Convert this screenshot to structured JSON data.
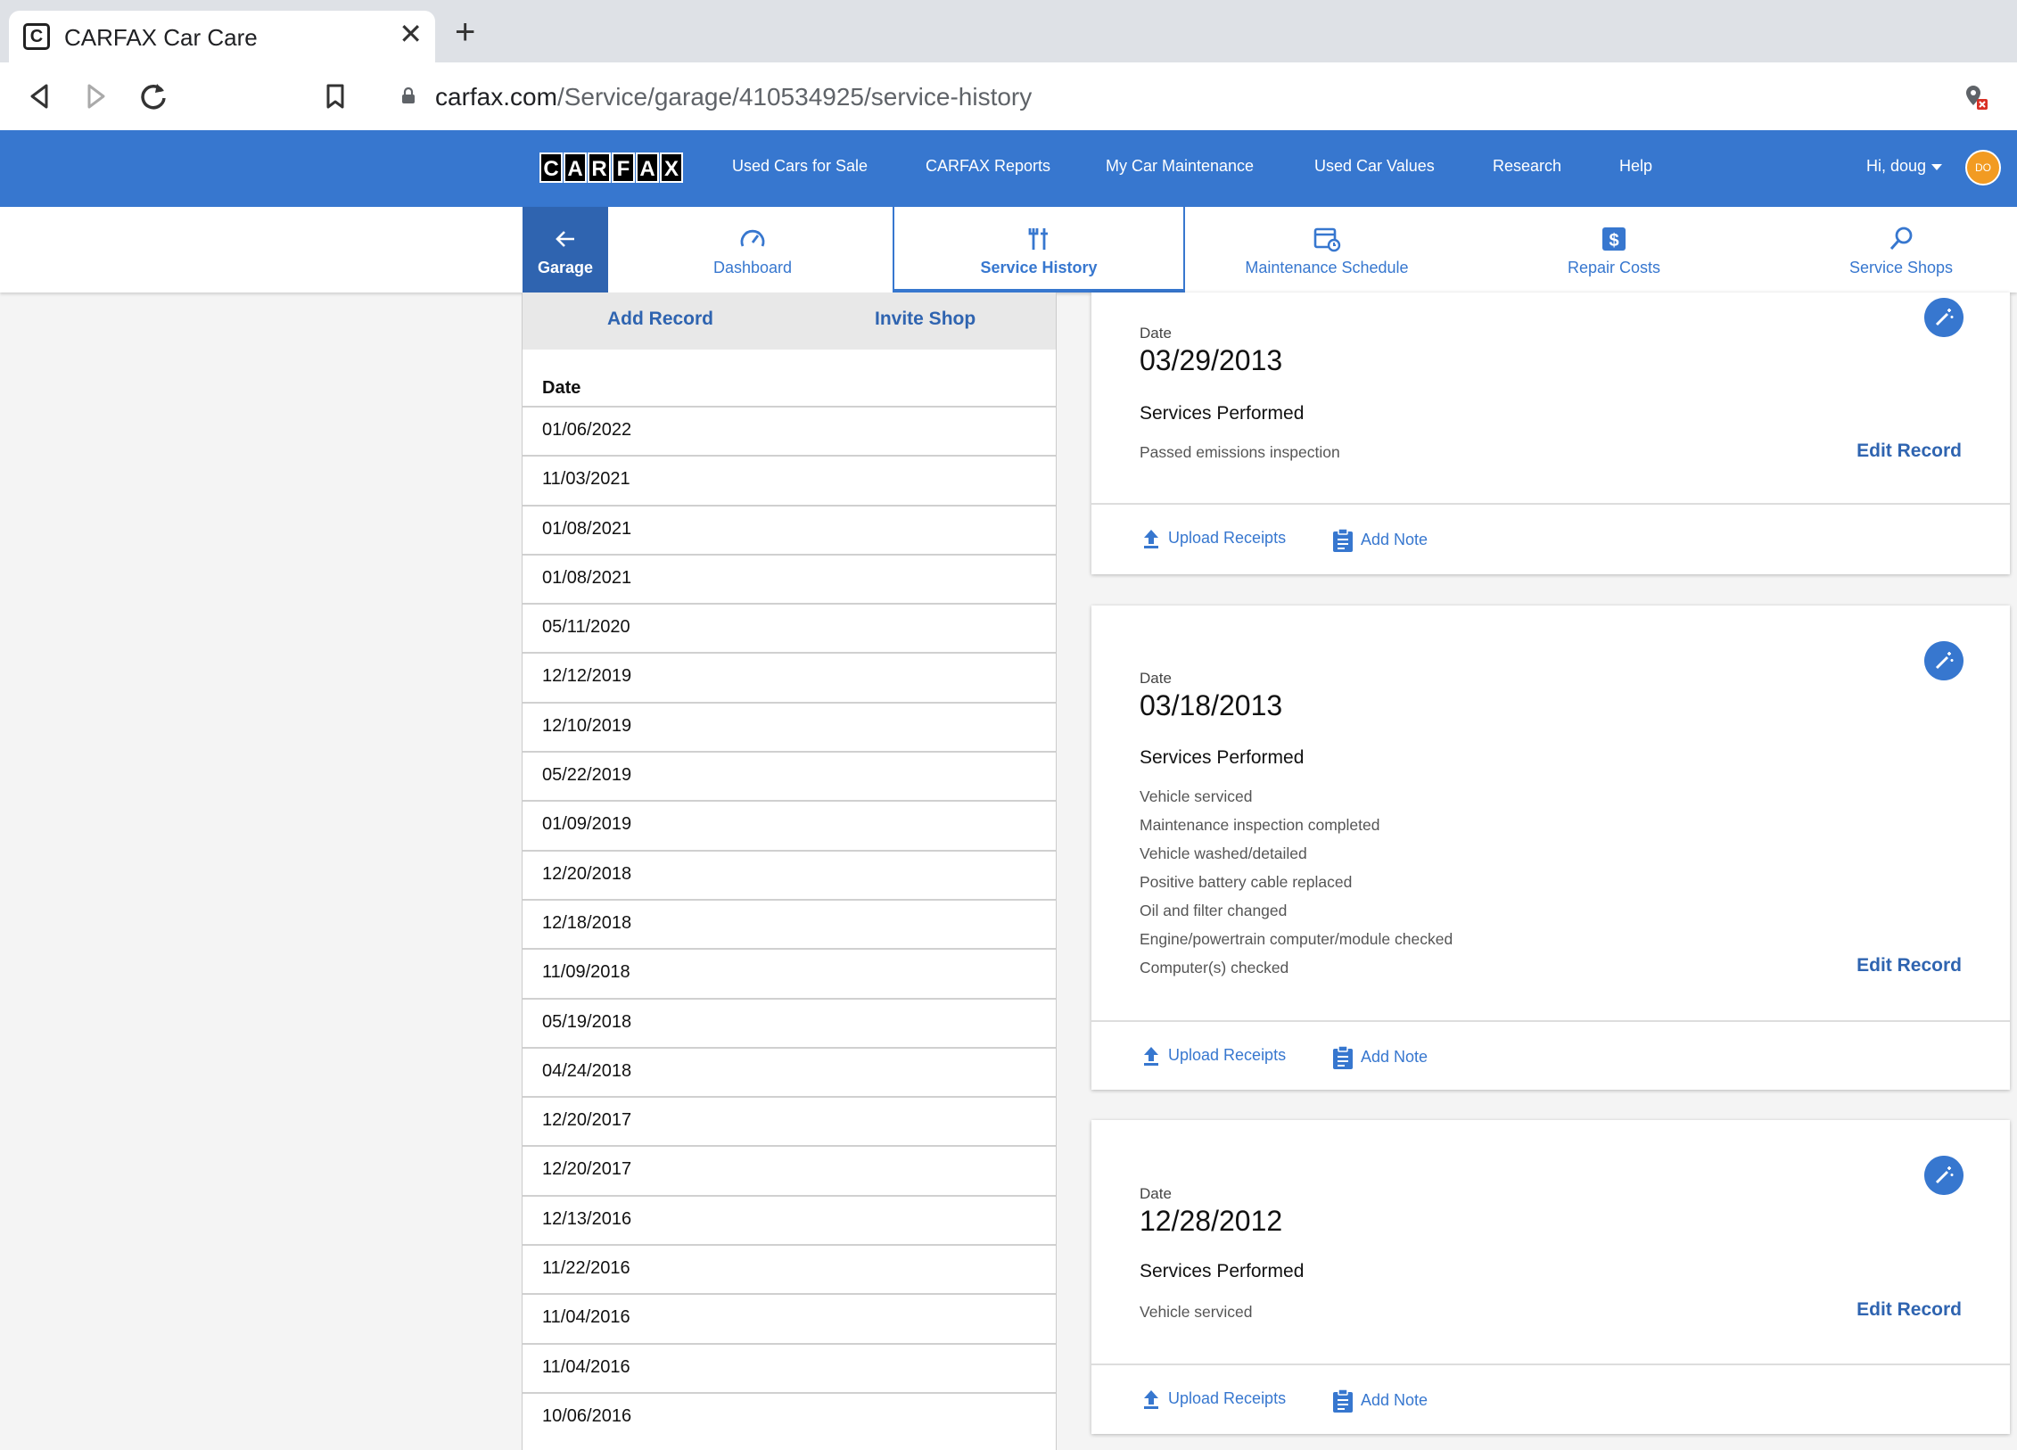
{
  "browser": {
    "tab_title": "CARFAX Car Care",
    "tab_close": "✕",
    "new_tab": "+",
    "url_host": "carfax.com",
    "url_path": "/Service/garage/410534925/service-history"
  },
  "header": {
    "logo_letters": [
      "C",
      "A",
      "R",
      "F",
      "A",
      "X"
    ],
    "nav": [
      "Used Cars for Sale",
      "CARFAX Reports",
      "My Car Maintenance",
      "Used Car Values",
      "Research",
      "Help"
    ],
    "greeting": "Hi, doug",
    "avatar_initials": "DO",
    "brand_color": "#3777cf"
  },
  "subnav": {
    "garage": "Garage",
    "dashboard": "Dashboard",
    "service_history": "Service History",
    "maintenance_schedule": "Maintenance Schedule",
    "repair_costs": "Repair Costs",
    "service_shops": "Service Shops"
  },
  "left_panel": {
    "add_record": "Add Record",
    "invite_shop": "Invite Shop",
    "date_header": "Date",
    "dates": [
      "01/06/2022",
      "11/03/2021",
      "01/08/2021",
      "01/08/2021",
      "05/11/2020",
      "12/12/2019",
      "12/10/2019",
      "05/22/2019",
      "01/09/2019",
      "12/20/2018",
      "12/18/2018",
      "11/09/2018",
      "05/19/2018",
      "04/24/2018",
      "12/20/2017",
      "12/20/2017",
      "12/13/2016",
      "11/22/2016",
      "11/04/2016",
      "11/04/2016",
      "10/06/2016"
    ]
  },
  "cards": [
    {
      "date_label": "Date",
      "date": "03/29/2013",
      "services_title": "Services Performed",
      "services": [
        "Passed emissions inspection"
      ],
      "edit": "Edit Record",
      "upload": "Upload Receipts",
      "note": "Add Note"
    },
    {
      "date_label": "Date",
      "date": "03/18/2013",
      "services_title": "Services Performed",
      "services": [
        "Vehicle serviced",
        "Maintenance inspection completed",
        "Vehicle washed/detailed",
        "Positive battery cable replaced",
        "Oil and filter changed",
        "Engine/powertrain computer/module checked",
        "Computer(s) checked"
      ],
      "edit": "Edit Record",
      "upload": "Upload Receipts",
      "note": "Add Note"
    },
    {
      "date_label": "Date",
      "date": "12/28/2012",
      "services_title": "Services Performed",
      "services": [
        "Vehicle serviced"
      ],
      "edit": "Edit Record",
      "upload": "Upload Receipts",
      "note": "Add Note"
    }
  ]
}
